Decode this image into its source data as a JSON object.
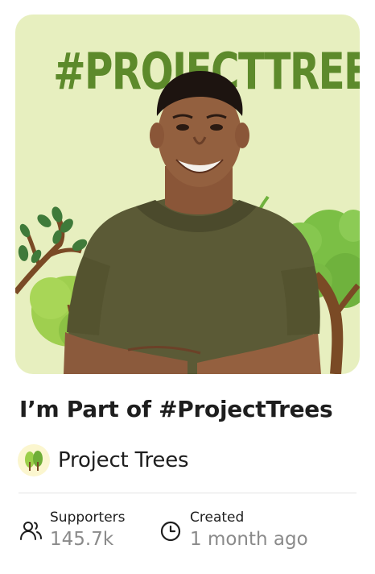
{
  "campaign": {
    "banner_heading": "#PROJECTTREES",
    "title": "I’m Part of #ProjectTrees",
    "organizer": "Project Trees"
  },
  "stats": {
    "supporters_label": "Supporters",
    "supporters_value": "145.7k",
    "created_label": "Created",
    "created_value": "1 month ago"
  },
  "icons": {
    "organizer_avatar": "tree-logo-icon",
    "supporters": "people-icon",
    "created": "clock-icon"
  },
  "colors": {
    "banner_background": "#e7efbf",
    "heading_green": "#5d8a2b",
    "muted_text": "#8a8a8a"
  }
}
